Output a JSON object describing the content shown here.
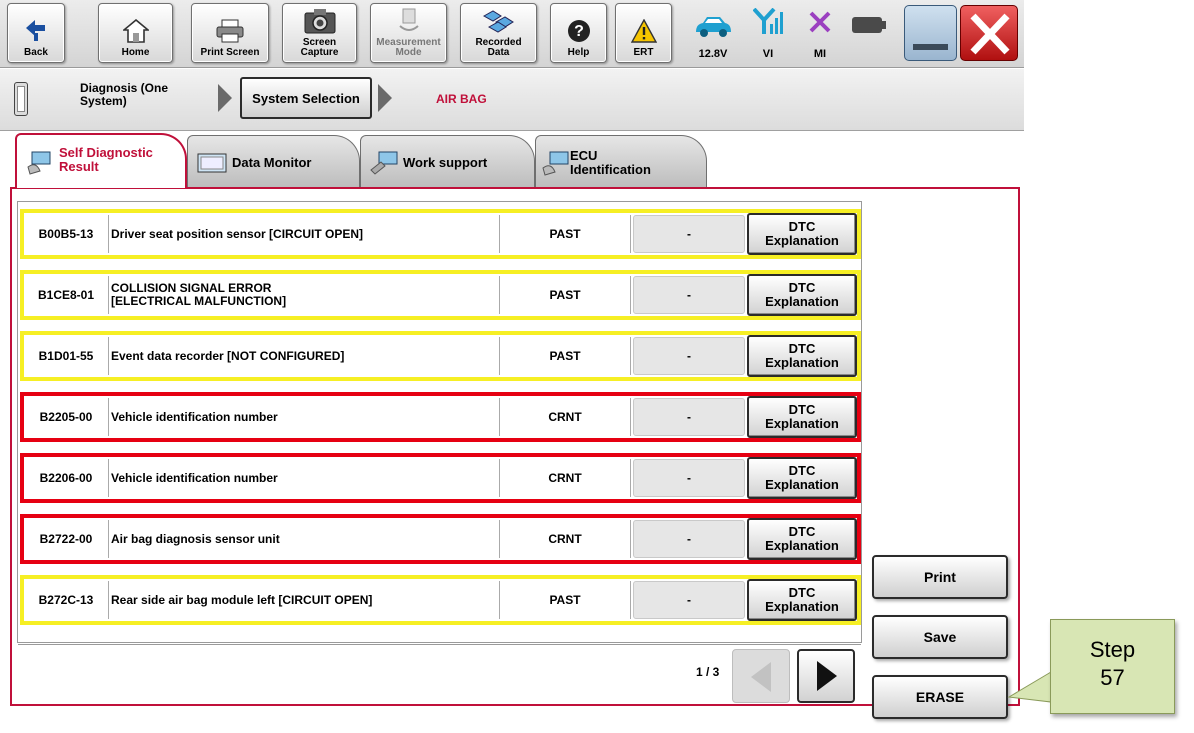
{
  "toolbar": {
    "back": "Back",
    "home": "Home",
    "print_screen": "Print Screen",
    "screen_capture": "Screen\nCapture",
    "measurement_mode": "Measurement\nMode",
    "recorded_data": "Recorded\nData",
    "help": "Help",
    "ert": "ERT",
    "battery_voltage": "12.8V",
    "vi": "VI",
    "mi": "MI"
  },
  "breadcrumb": {
    "step1": "Diagnosis (One\nSystem)",
    "step2": "System Selection",
    "step3": "AIR BAG"
  },
  "tabs": [
    {
      "label": "Self Diagnostic\nResult"
    },
    {
      "label": "Data Monitor"
    },
    {
      "label": "Work support"
    },
    {
      "label": "ECU\nIdentification"
    }
  ],
  "dtc_rows": [
    {
      "code": "B00B5-13",
      "description": "Driver seat position sensor [CIRCUIT OPEN]",
      "status": "PAST",
      "count": "-",
      "button": "DTC\nExplanation"
    },
    {
      "code": "B1CE8-01",
      "description": "COLLISION SIGNAL ERROR [ELECTRICAL MALFUNCTION]",
      "status": "PAST",
      "count": "-",
      "button": "DTC\nExplanation"
    },
    {
      "code": "B1D01-55",
      "description": "Event data recorder [NOT CONFIGURED]",
      "status": "PAST",
      "count": "-",
      "button": "DTC\nExplanation"
    },
    {
      "code": "B2205-00",
      "description": "Vehicle identification number",
      "status": "CRNT",
      "count": "-",
      "button": "DTC\nExplanation"
    },
    {
      "code": "B2206-00",
      "description": "Vehicle identification number",
      "status": "CRNT",
      "count": "-",
      "button": "DTC\nExplanation"
    },
    {
      "code": "B2722-00",
      "description": "Air bag diagnosis sensor unit",
      "status": "CRNT",
      "count": "-",
      "button": "DTC\nExplanation"
    },
    {
      "code": "B272C-13",
      "description": "Rear side air bag module left [CIRCUIT OPEN]",
      "status": "PAST",
      "count": "-",
      "button": "DTC\nExplanation"
    }
  ],
  "actions": {
    "print": "Print",
    "save": "Save",
    "erase": "ERASE"
  },
  "pager": {
    "text": "1 / 3"
  },
  "callout": {
    "text": "Step\n57"
  },
  "colors": {
    "past_border": "#f6ef24",
    "crnt_border": "#e60012",
    "panel_border": "#c0103a",
    "callout_bg": "#d8e6b4"
  }
}
